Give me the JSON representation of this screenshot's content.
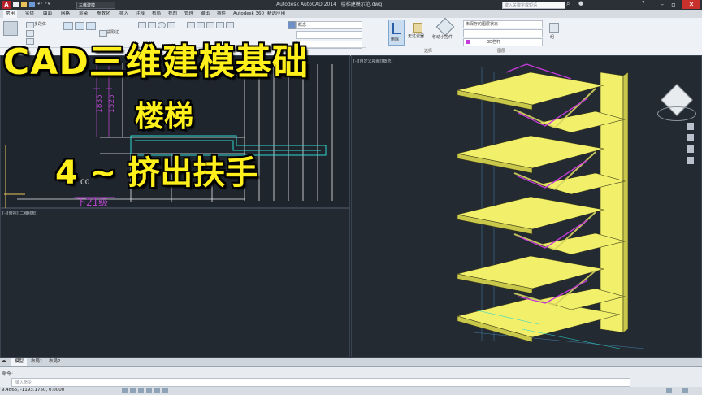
{
  "window": {
    "title": "Autodesk AutoCAD 2014",
    "file_name": "楼梯建模示范.dwg",
    "workspace": "三维建模",
    "search_placeholder": "键入关键字或短语"
  },
  "ribbon_tabs": [
    "常用",
    "实体",
    "曲面",
    "网格",
    "渲染",
    "参数化",
    "插入",
    "注释",
    "布局",
    "视图",
    "管理",
    "输出",
    "插件",
    "Autodesk 360",
    "精选应用"
  ],
  "active_tab": "常用",
  "ribbon": {
    "extrude_label": "多段体",
    "extract_label": "提取边",
    "layer_label": "概念",
    "delete_label": "删除",
    "filter_label": "无过滤器",
    "gizmo_label": "移动小控件",
    "selection_panel": "选择",
    "layer_state": "未保存的图层状态",
    "rail_label": "3D栏杆",
    "layers_panel": "图层",
    "group_label": "组"
  },
  "viewports": {
    "left_bottom_label": "[-][俯视][二维线框]",
    "right_label": "[-][自定义视图][概念]"
  },
  "drawing": {
    "dim1": "1835",
    "dim2": "1525",
    "dim3": "4",
    "dim4": "00",
    "stair_label": "下21级"
  },
  "layout_tabs": [
    "模型",
    "布局1",
    "布局2"
  ],
  "command": {
    "prompt": "命令:",
    "input_placeholder": "键入命令"
  },
  "status": {
    "coords": "9.4865, -1193.1750, 0.0000"
  },
  "overlay": {
    "line1": "CAD三维建模基础",
    "line2": "楼梯",
    "line3": "4 ~ 挤出扶手"
  },
  "colors": {
    "overlay_text": "#ffef1a",
    "slab": "#f2f06a",
    "rail": "#c43bd8",
    "dim_magenta": "#b246c8",
    "cyan": "#2fd6cf"
  }
}
